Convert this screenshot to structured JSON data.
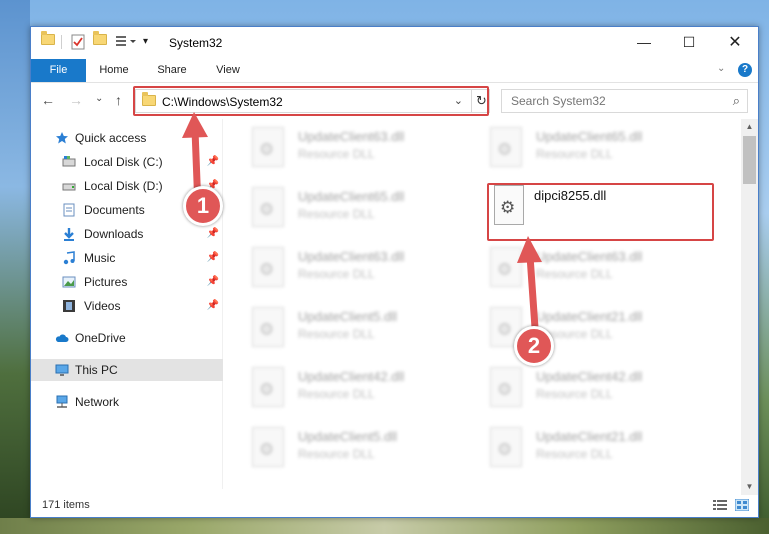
{
  "window": {
    "title": "System32"
  },
  "ribbon": {
    "tabs": [
      "File",
      "Home",
      "Share",
      "View"
    ]
  },
  "address": {
    "path": "C:\\Windows\\System32"
  },
  "search": {
    "placeholder": "Search System32"
  },
  "nav_pane": {
    "items": [
      {
        "label": "Quick access",
        "icon": "star-icon",
        "pinned": false
      },
      {
        "label": "Local Disk (C:)",
        "icon": "drive-icon",
        "pinned": true
      },
      {
        "label": "Local Disk (D:)",
        "icon": "drive-icon",
        "pinned": true
      },
      {
        "label": "Documents",
        "icon": "documents-icon",
        "pinned": true
      },
      {
        "label": "Downloads",
        "icon": "download-icon",
        "pinned": true
      },
      {
        "label": "Music",
        "icon": "music-icon",
        "pinned": true
      },
      {
        "label": "Pictures",
        "icon": "pictures-icon",
        "pinned": true
      },
      {
        "label": "Videos",
        "icon": "videos-icon",
        "pinned": true
      },
      {
        "label": "OneDrive",
        "icon": "cloud-icon",
        "pinned": false
      },
      {
        "label": "This PC",
        "icon": "computer-icon",
        "pinned": false
      },
      {
        "label": "Network",
        "icon": "network-icon",
        "pinned": false
      }
    ],
    "selected": "This PC"
  },
  "files": {
    "left_column": [
      {
        "name": "UpdateClient63.dll",
        "type": "Resource DLL"
      },
      {
        "name": "UpdateClient65.dll",
        "type": "Resource DLL"
      },
      {
        "name": "UpdateClient63.dll",
        "type": "Resource DLL"
      },
      {
        "name": "UpdateClient5.dll",
        "type": "Resource DLL"
      },
      {
        "name": "UpdateClient42.dll",
        "type": "Resource DLL"
      },
      {
        "name": "UpdateClient5.dll",
        "type": "Resource DLL"
      }
    ],
    "right_column": [
      {
        "name": "UpdateClient65.dll",
        "type": "Resource DLL"
      },
      {
        "name": "UpdateClient63.dll",
        "type": "Resource DLL"
      },
      {
        "name": "UpdateClient21.dll",
        "type": "Resource DLL"
      },
      {
        "name": "UpdateClient42.dll",
        "type": "Resource DLL"
      },
      {
        "name": "UpdateClient21.dll",
        "type": "Resource DLL"
      }
    ],
    "highlighted": {
      "name": "dipci8255.dll"
    }
  },
  "status": {
    "item_count": "171 items"
  },
  "annotations": {
    "step1": "1",
    "step2": "2",
    "color": "#d64545"
  }
}
